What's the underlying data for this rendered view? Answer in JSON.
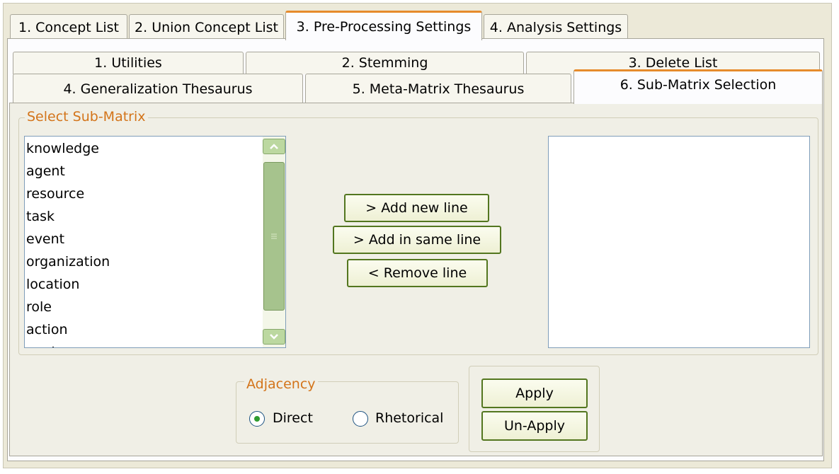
{
  "main_tabs": [
    {
      "label": "1. Concept List"
    },
    {
      "label": "2. Union Concept List"
    },
    {
      "label": "3. Pre-Processing Settings",
      "active": true
    },
    {
      "label": "4. Analysis Settings"
    }
  ],
  "sub_tabs_row1": [
    {
      "label": "1. Utilities"
    },
    {
      "label": "2. Stemming"
    },
    {
      "label": "3. Delete List"
    }
  ],
  "sub_tabs_row2": [
    {
      "label": "4. Generalization Thesaurus"
    },
    {
      "label": "5. Meta-Matrix Thesaurus"
    },
    {
      "label": "6. Sub-Matrix Selection",
      "active": true
    }
  ],
  "select_group": {
    "title": "Select Sub-Matrix",
    "items": [
      "knowledge",
      "agent",
      "resource",
      "task",
      "event",
      "organization",
      "location",
      "role",
      "action",
      "goal"
    ],
    "selected_items": []
  },
  "buttons": {
    "add_new_line": "> Add new line",
    "add_same_line": "> Add in same line",
    "remove_line": "< Remove line",
    "apply": "Apply",
    "unapply": "Un-Apply"
  },
  "adjacency": {
    "title": "Adjacency",
    "options": [
      "Direct",
      "Rhetorical"
    ],
    "selected": "Direct"
  },
  "colors": {
    "accent": "#e68b2c",
    "group_title": "#d3741a",
    "button_border": "#53761f",
    "scrollbar": "#a6c38d",
    "radio_dot": "#2f9b2f"
  }
}
